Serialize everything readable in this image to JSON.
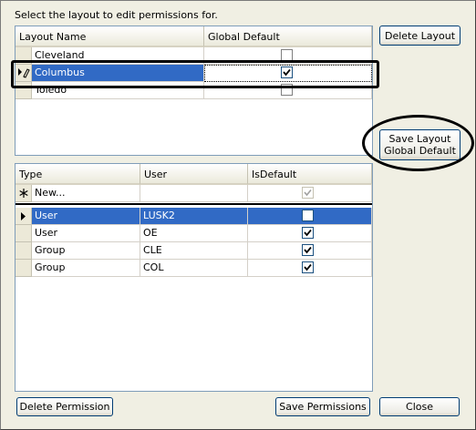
{
  "instruction": "Select the layout to edit permissions for.",
  "buttons": {
    "delete_layout": "Delete Layout",
    "save_layout_default": "Save Layout\nGlobal Default",
    "delete_permission": "Delete Permission",
    "save_permissions": "Save Permissions",
    "close": "Close"
  },
  "layouts_grid": {
    "headers": [
      "Layout Name",
      "Global Default"
    ],
    "rows": [
      {
        "name": "Cleveland",
        "global_default": false,
        "selected": false
      },
      {
        "name": "Columbus",
        "global_default": true,
        "selected": true,
        "editing": true
      },
      {
        "name": "Toledo",
        "global_default": false,
        "selected": false
      }
    ]
  },
  "permissions_grid": {
    "headers": [
      "Type",
      "User",
      "IsDefault"
    ],
    "new_row_label": "New...",
    "rows": [
      {
        "type": "User",
        "user": "LUSK2",
        "is_default": false,
        "selected": true
      },
      {
        "type": "User",
        "user": "OE",
        "is_default": true,
        "selected": false
      },
      {
        "type": "Group",
        "user": "CLE",
        "is_default": true,
        "selected": false
      },
      {
        "type": "Group",
        "user": "COL",
        "is_default": true,
        "selected": false
      }
    ]
  },
  "icons": {
    "current_row": "triangle-right-icon",
    "edit_row": "pencil-icon",
    "new_row": "asterisk-icon"
  },
  "colors": {
    "selection": "#316ac5",
    "background": "#f0efe3",
    "button_border": "#003c74"
  }
}
